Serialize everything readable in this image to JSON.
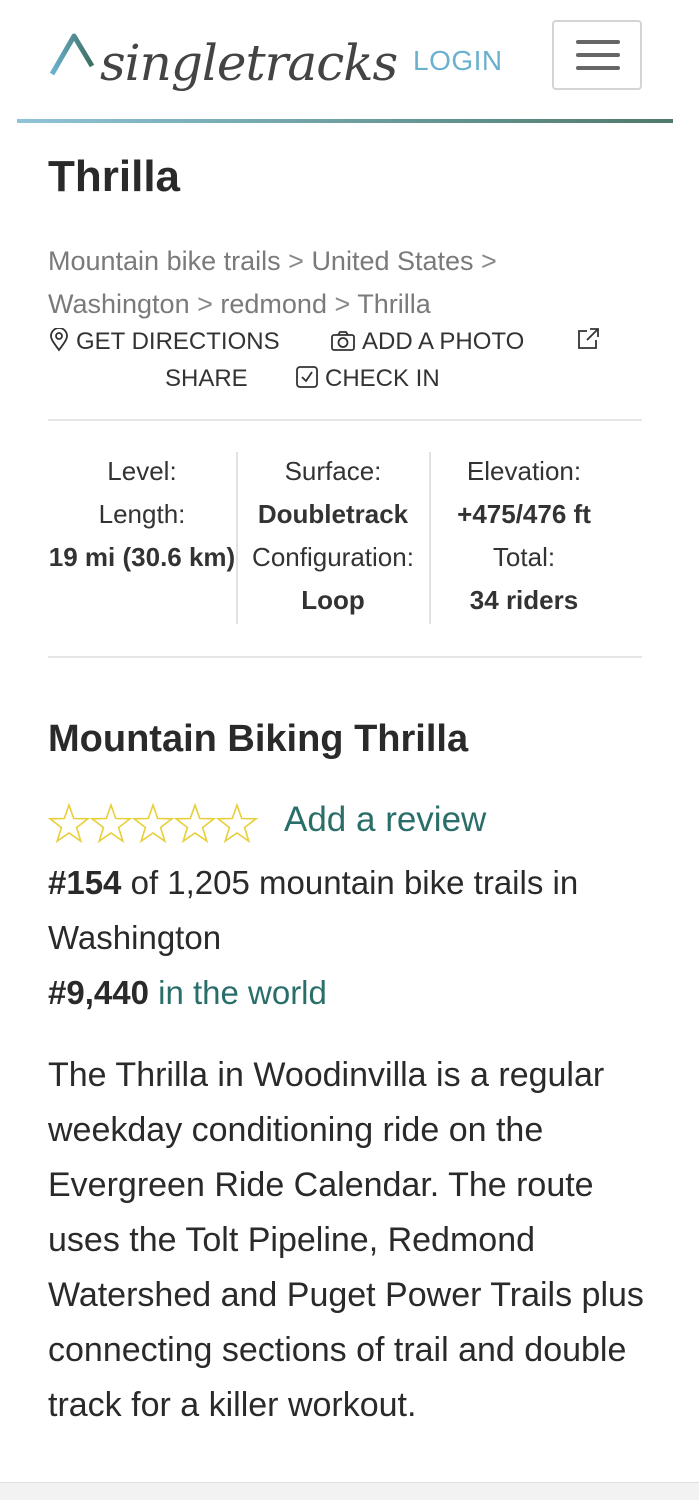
{
  "header": {
    "logo_text": "singletracks",
    "login_label": "LOGIN",
    "menu_icon": "hamburger-icon",
    "rule_gradient": [
      "#8fc4d8",
      "#4d7a6a"
    ]
  },
  "trail": {
    "title": "Thrilla",
    "breadcrumbs": [
      "Mountain bike trails",
      "United States",
      "Washington",
      "redmond",
      "Thrilla"
    ],
    "breadcrumb_sep": ">"
  },
  "actions": {
    "directions": "GET DIRECTIONS",
    "photo": "ADD A PHOTO",
    "share": "SHARE",
    "checkin": "CHECK IN"
  },
  "stats": {
    "level_label": "Level:",
    "length_label": "Length:",
    "length_value": "19 mi (30.6 km)",
    "surface_label": "Surface:",
    "surface_value": "Doubletrack",
    "config_label": "Configuration:",
    "config_value": "Loop",
    "elevation_label": "Elevation:",
    "elevation_value": "+475/476 ft",
    "total_label": "Total:",
    "total_value": "34 riders"
  },
  "section": {
    "heading": "Mountain Biking Thrilla",
    "rating_stars": 0,
    "rating_max": 5,
    "add_review": "Add a review",
    "state_rank": "#154",
    "state_rank_text": "of 1,205 mountain bike trails in Washington",
    "world_rank": "#9,440",
    "world_rank_text": "in the world"
  },
  "description": "The Thrilla in Woodinvilla is a regular weekday conditioning ride on the Evergreen Ride Calendar. The route uses the Tolt Pipeline, Redmond Watershed and Puget Power Trails plus connecting sections of trail and double track for a killer workout.",
  "colors": {
    "accent_link": "#2a6e6a",
    "login_blue": "#6bb1cf",
    "star_outline": "#e8cf3a"
  }
}
